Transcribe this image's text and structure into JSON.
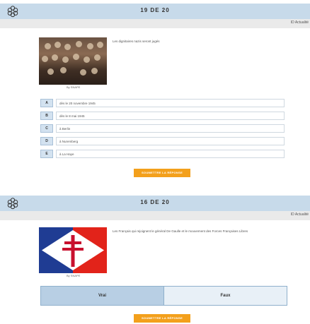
{
  "panel1": {
    "title": "19 DE 20",
    "subbar_text": "ID Actualité",
    "question": "Les dignitaires nazis seront jugés",
    "image_credit": "By SNAPE",
    "choices": [
      {
        "letter": "A",
        "text": "dès le 20 novembre 1945"
      },
      {
        "letter": "B",
        "text": "dès le 8 mai 1945"
      },
      {
        "letter": "C",
        "text": "à Berlin"
      },
      {
        "letter": "D",
        "text": "à Nuremberg"
      },
      {
        "letter": "E",
        "text": "à La Haye"
      }
    ],
    "submit_label": "SOUMETTRE LA RÉPONSE"
  },
  "panel2": {
    "title": "16 DE 20",
    "subbar_text": "ID Actualité",
    "question": "Les Français qui rejoignent le général De Gaulle et le mouvement des Forces Françaises Libres",
    "image_credit": "By SNAPE",
    "true_label": "Vrai",
    "false_label": "Faux",
    "submit_label": "SOUMETTRE LA RÉPONSE"
  },
  "icons": {
    "logo": "hexagon-molecule-logo-icon"
  },
  "colors": {
    "header": "#c7daea",
    "accent": "#f3a01c",
    "flag_blue": "#1f3c93",
    "flag_red": "#e2231a",
    "cross": "#c8102e"
  }
}
